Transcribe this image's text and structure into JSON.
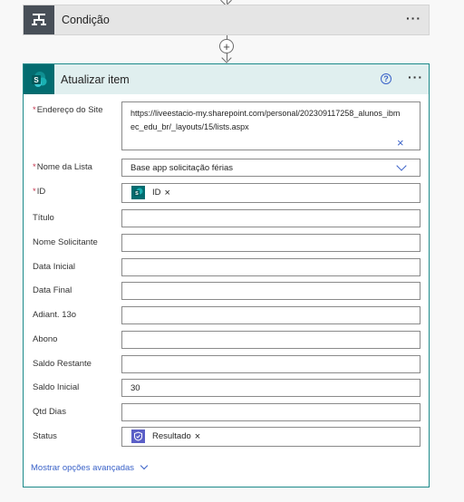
{
  "condition_card": {
    "title": "Condição"
  },
  "action_card": {
    "title": "Atualizar item",
    "help_symbol": "?",
    "fields": {
      "site_address": {
        "label": "Endereço do Site",
        "required": true,
        "value": "https://liveestacio-my.sharepoint.com/personal/202309117258_alunos_ibmec_edu_br/_layouts/15/lists.aspx"
      },
      "list_name": {
        "label": "Nome da Lista",
        "required": true,
        "value": "Base app solicitação férias"
      },
      "id": {
        "label": "ID",
        "required": true,
        "token": "ID"
      },
      "titulo": {
        "label": "Título",
        "value": ""
      },
      "nome_solicitante": {
        "label": "Nome Solicitante",
        "value": ""
      },
      "data_inicial": {
        "label": "Data Inicial",
        "value": ""
      },
      "data_final": {
        "label": "Data Final",
        "value": ""
      },
      "adiant": {
        "label": "Adiant. 13o",
        "value": ""
      },
      "abono": {
        "label": "Abono",
        "value": ""
      },
      "saldo_restante": {
        "label": "Saldo Restante",
        "value": ""
      },
      "saldo_inicial": {
        "label": "Saldo Inicial",
        "value": "30"
      },
      "qtd_dias": {
        "label": "Qtd Dias",
        "value": ""
      },
      "status": {
        "label": "Status",
        "token": "Resultado"
      }
    },
    "advanced_link": "Mostrar opções avançadas"
  },
  "icons": {
    "condition": "condition-icon",
    "sharepoint": "sharepoint-icon",
    "approval": "approval-icon"
  },
  "colors": {
    "sharepoint_teal": "#036c70",
    "card_border": "#1c8a8a",
    "header_bg": "#e0efef",
    "condition_icon_bg": "#484f58",
    "link_blue": "#3a62c8",
    "required_red": "#c4314b",
    "approval_purple": "#5b5fc7"
  },
  "glyphs": {
    "more": "···",
    "plus": "+",
    "close": "×",
    "required": "*"
  }
}
